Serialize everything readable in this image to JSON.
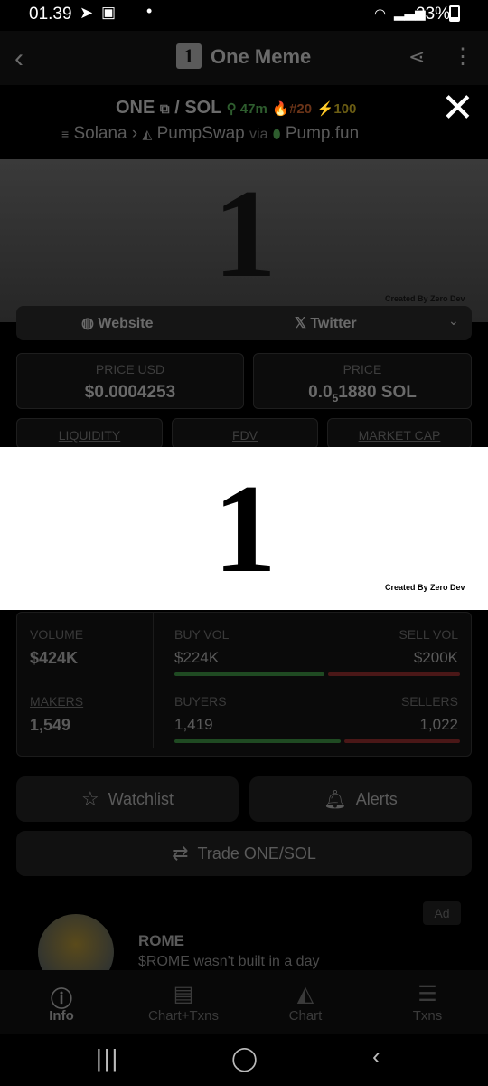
{
  "status_bar": {
    "time": "01.39",
    "battery": "23%"
  },
  "app_bar": {
    "logo_glyph": "1",
    "title": "One Meme"
  },
  "pair": {
    "base": "ONE",
    "quote": "SOL",
    "age": "47m",
    "rank": "#20",
    "boost": "100"
  },
  "chain": {
    "network": "Solana",
    "dex": "PumpSwap",
    "via": "via",
    "launchpad": "Pump.fun"
  },
  "hero": {
    "glyph": "1",
    "credit": "Created By Zero Dev"
  },
  "links": {
    "website": "Website",
    "twitter": "Twitter"
  },
  "price": {
    "usd_label": "PRICE USD",
    "usd_value": "$0.0004253",
    "native_label": "PRICE",
    "native_prefix": "0.0",
    "native_sub": "5",
    "native_rest": "1880 SOL"
  },
  "metric_tabs": {
    "liquidity": "LIQUIDITY",
    "fdv": "FDV",
    "mcap": "MARKET CAP"
  },
  "banner": {
    "glyph": "1",
    "credit": "Created By Zero Dev"
  },
  "stats": {
    "volume_label": "VOLUME",
    "volume": "$424K",
    "buy_vol_label": "BUY VOL",
    "buy_vol": "$224K",
    "sell_vol_label": "SELL VOL",
    "sell_vol": "$200K",
    "makers_label": "MAKERS",
    "makers": "1,549",
    "buyers_label": "BUYERS",
    "buyers": "1,419",
    "sellers_label": "SELLERS",
    "sellers": "1,022"
  },
  "actions": {
    "watchlist": "Watchlist",
    "alerts": "Alerts",
    "trade": "Trade ONE/SOL"
  },
  "ad": {
    "badge": "Ad",
    "title": "ROME",
    "desc": "$ROME wasn't built in a day"
  },
  "bottom_nav": [
    {
      "label": "Info",
      "icon": "info-icon"
    },
    {
      "label": "Chart+Txns",
      "icon": "layout-icon"
    },
    {
      "label": "Chart",
      "icon": "area-chart-icon"
    },
    {
      "label": "Txns",
      "icon": "list-icon"
    }
  ],
  "colors": {
    "buy": "#1f4a22",
    "sell": "#4a1717",
    "banner_bg": "#ffffff"
  }
}
